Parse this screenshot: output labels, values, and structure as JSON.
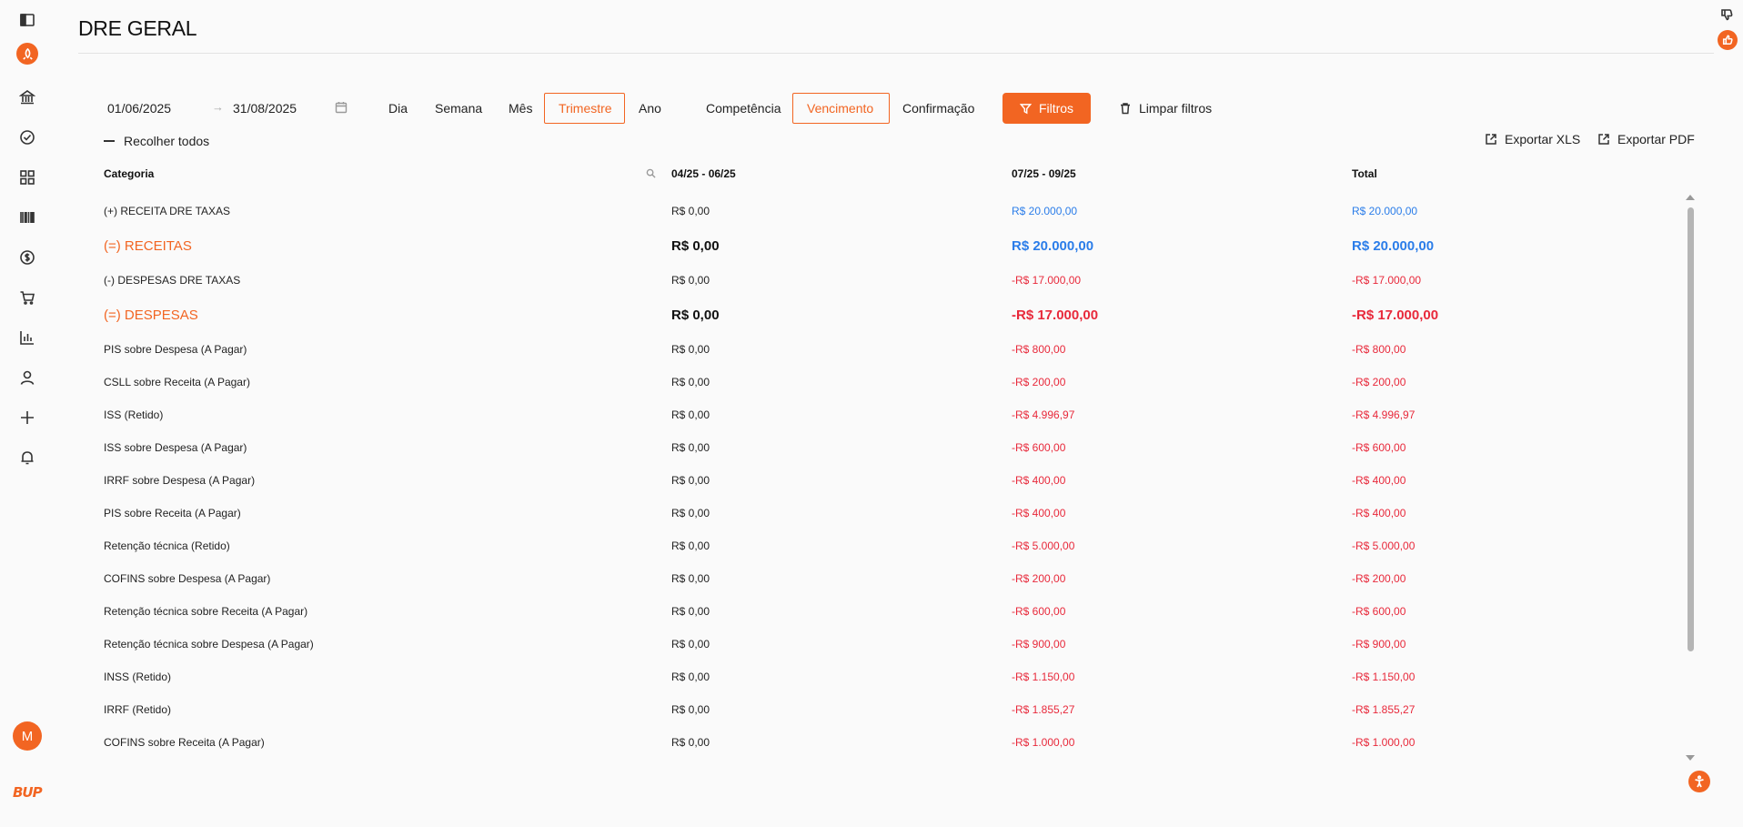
{
  "page": {
    "title": "DRE GERAL"
  },
  "sidebar": {
    "icons": [
      "sidebar-toggle-icon",
      "rocket-icon",
      "bank-icon",
      "check-circle-icon",
      "grid-icon",
      "barcode-icon",
      "dollar-circle-icon",
      "cart-icon",
      "bar-chart-icon",
      "user-icon",
      "plus-icon",
      "bell-icon"
    ],
    "avatar_letter": "M",
    "logo_text": "BUP"
  },
  "filters": {
    "date_from": "01/06/2025",
    "date_arrow": "→",
    "date_to": "31/08/2025",
    "periods": [
      "Dia",
      "Semana",
      "Mês",
      "Trimestre",
      "Ano"
    ],
    "active_period": "Trimestre",
    "modes": [
      "Competência",
      "Vencimento",
      "Confirmação"
    ],
    "active_mode": "Vencimento",
    "filtros_label": "Filtros",
    "limpar_label": "Limpar filtros"
  },
  "toolbar": {
    "collapse_label": "Recolher todos",
    "export_xls": "Exportar XLS",
    "export_pdf": "Exportar PDF"
  },
  "table": {
    "headers": [
      "Categoria",
      "04/25 - 06/25",
      "07/25 - 09/25",
      "Total"
    ],
    "rows": [
      {
        "category": "(+) RECEITA DRE TAXAS",
        "p1": "R$ 0,00",
        "p2": "R$ 20.000,00",
        "total": "R$ 20.000,00",
        "kind": "small",
        "sign": "pos"
      },
      {
        "category": "(=) RECEITAS",
        "p1": "R$ 0,00",
        "p2": "R$ 20.000,00",
        "total": "R$ 20.000,00",
        "kind": "big",
        "sign": "pos"
      },
      {
        "category": "(-) DESPESAS DRE TAXAS",
        "p1": "R$ 0,00",
        "p2": "-R$ 17.000,00",
        "total": "-R$ 17.000,00",
        "kind": "small",
        "sign": "neg"
      },
      {
        "category": "(=) DESPESAS",
        "p1": "R$ 0,00",
        "p2": "-R$ 17.000,00",
        "total": "-R$ 17.000,00",
        "kind": "big",
        "sign": "neg"
      },
      {
        "category": "PIS sobre Despesa (A Pagar)",
        "p1": "R$ 0,00",
        "p2": "-R$ 800,00",
        "total": "-R$ 800,00",
        "kind": "small",
        "sign": "neg"
      },
      {
        "category": "CSLL sobre Receita (A Pagar)",
        "p1": "R$ 0,00",
        "p2": "-R$ 200,00",
        "total": "-R$ 200,00",
        "kind": "small",
        "sign": "neg"
      },
      {
        "category": "ISS (Retido)",
        "p1": "R$ 0,00",
        "p2": "-R$ 4.996,97",
        "total": "-R$ 4.996,97",
        "kind": "small",
        "sign": "neg"
      },
      {
        "category": "ISS sobre Despesa (A Pagar)",
        "p1": "R$ 0,00",
        "p2": "-R$ 600,00",
        "total": "-R$ 600,00",
        "kind": "small",
        "sign": "neg"
      },
      {
        "category": "IRRF sobre Despesa (A Pagar)",
        "p1": "R$ 0,00",
        "p2": "-R$ 400,00",
        "total": "-R$ 400,00",
        "kind": "small",
        "sign": "neg"
      },
      {
        "category": "PIS sobre Receita (A Pagar)",
        "p1": "R$ 0,00",
        "p2": "-R$ 400,00",
        "total": "-R$ 400,00",
        "kind": "small",
        "sign": "neg"
      },
      {
        "category": "Retenção técnica (Retido)",
        "p1": "R$ 0,00",
        "p2": "-R$ 5.000,00",
        "total": "-R$ 5.000,00",
        "kind": "small",
        "sign": "neg"
      },
      {
        "category": "COFINS sobre Despesa (A Pagar)",
        "p1": "R$ 0,00",
        "p2": "-R$ 200,00",
        "total": "-R$ 200,00",
        "kind": "small",
        "sign": "neg"
      },
      {
        "category": "Retenção técnica sobre Receita (A Pagar)",
        "p1": "R$ 0,00",
        "p2": "-R$ 600,00",
        "total": "-R$ 600,00",
        "kind": "small",
        "sign": "neg"
      },
      {
        "category": "Retenção técnica sobre Despesa (A Pagar)",
        "p1": "R$ 0,00",
        "p2": "-R$ 900,00",
        "total": "-R$ 900,00",
        "kind": "small",
        "sign": "neg"
      },
      {
        "category": "INSS (Retido)",
        "p1": "R$ 0,00",
        "p2": "-R$ 1.150,00",
        "total": "-R$ 1.150,00",
        "kind": "small",
        "sign": "neg"
      },
      {
        "category": "IRRF (Retido)",
        "p1": "R$ 0,00",
        "p2": "-R$ 1.855,27",
        "total": "-R$ 1.855,27",
        "kind": "small",
        "sign": "neg"
      },
      {
        "category": "COFINS sobre Receita (A Pagar)",
        "p1": "R$ 0,00",
        "p2": "-R$ 1.000,00",
        "total": "-R$ 1.000,00",
        "kind": "small",
        "sign": "neg"
      }
    ]
  },
  "colors": {
    "accent": "#f26522",
    "positive": "#2b7de9",
    "negative": "#e8293b"
  }
}
